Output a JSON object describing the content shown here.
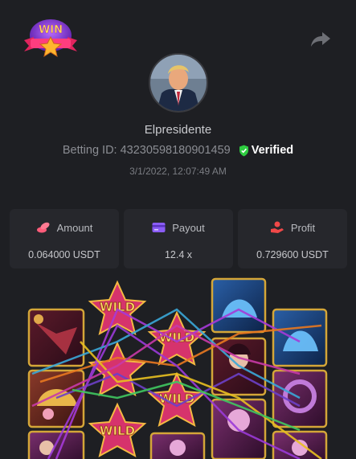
{
  "header": {
    "logo_text": "WIN",
    "share_icon": "share-icon"
  },
  "profile": {
    "username": "Elpresidente",
    "betting_id_label": "Betting ID:",
    "betting_id": "43230598180901459",
    "verified_label": "Verified",
    "timestamp": "3/1/2022, 12:07:49 AM"
  },
  "stats": {
    "amount": {
      "label": "Amount",
      "value": "0.064000 USDT",
      "icon": "coins-icon"
    },
    "payout": {
      "label": "Payout",
      "value": "12.4 x",
      "icon": "card-icon"
    },
    "profit": {
      "label": "Profit",
      "value": "0.729600 USDT",
      "icon": "profit-hand-icon"
    }
  },
  "game": {
    "wild_text": "WILD"
  },
  "colors": {
    "background": "#1e1f23",
    "card": "#26272c",
    "verified_green": "#2ecc40",
    "amount_icon": "#ff5c7a",
    "payout_icon": "#8a5cf6",
    "profit_icon": "#f04848",
    "tile_border": "#d4a638"
  }
}
